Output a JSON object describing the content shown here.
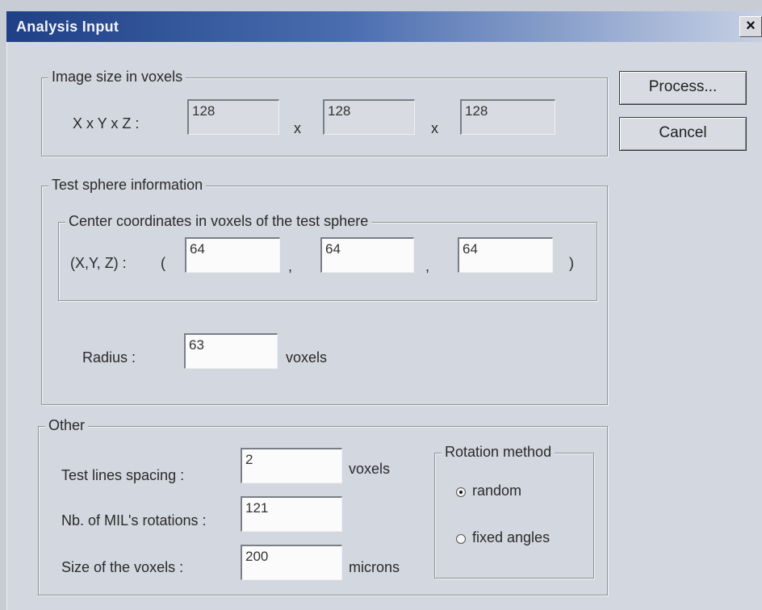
{
  "window": {
    "title": "Analysis Input",
    "close_glyph": "×"
  },
  "buttons": {
    "process": "Process...",
    "cancel": "Cancel"
  },
  "image_size": {
    "legend": "Image size in voxels",
    "label": "X x Y x Z :",
    "x": "128",
    "y": "128",
    "z": "128",
    "sep": "x"
  },
  "test_sphere": {
    "legend": "Test sphere information",
    "center": {
      "legend": "Center coordinates in voxels of the test sphere",
      "label": "(X,Y, Z) :",
      "open_paren": "(",
      "close_paren": ")",
      "comma": ",",
      "x": "64",
      "y": "64",
      "z": "64"
    },
    "radius_label": "Radius :",
    "radius": "63",
    "radius_unit": "voxels"
  },
  "other": {
    "legend": "Other",
    "spacing_label": "Test lines spacing :",
    "spacing": "2",
    "spacing_unit": "voxels",
    "rotations_label": "Nb. of MIL's rotations :",
    "rotations": "121",
    "voxel_size_label": "Size of the voxels :",
    "voxel_size": "200",
    "voxel_size_unit": "microns",
    "rotation_method": {
      "legend": "Rotation method",
      "options": [
        "random",
        "fixed angles"
      ],
      "selected": "random"
    }
  },
  "colors": {
    "title_start": "#1f3f86",
    "title_end": "#c6d0e4",
    "dialog_bg": "#d3d7df"
  }
}
